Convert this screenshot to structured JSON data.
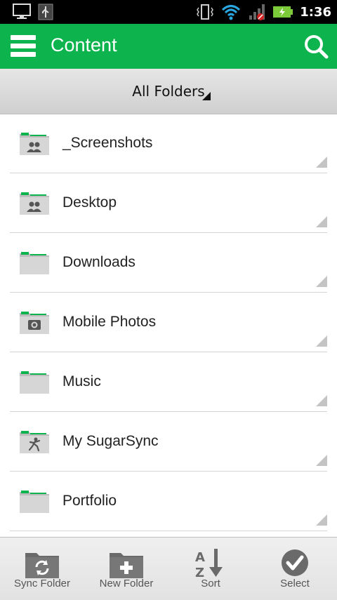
{
  "status_bar": {
    "time": "1:36"
  },
  "app_bar": {
    "title": "Content"
  },
  "filter": {
    "label": "All Folders"
  },
  "folders": [
    {
      "name": "_Screenshots",
      "icon": "shared-folder-icon"
    },
    {
      "name": "Desktop",
      "icon": "shared-folder-icon"
    },
    {
      "name": "Downloads",
      "icon": "folder-icon"
    },
    {
      "name": "Mobile Photos",
      "icon": "camera-folder-icon"
    },
    {
      "name": "Music",
      "icon": "folder-icon"
    },
    {
      "name": "My SugarSync",
      "icon": "sugarsync-folder-icon"
    },
    {
      "name": "Portfolio",
      "icon": "folder-icon"
    }
  ],
  "toolbar": {
    "sync_folder": "Sync Folder",
    "new_folder": "New Folder",
    "sort": "Sort",
    "select": "Select"
  },
  "colors": {
    "accent": "#0DB44D",
    "status_bar": "#000000"
  }
}
